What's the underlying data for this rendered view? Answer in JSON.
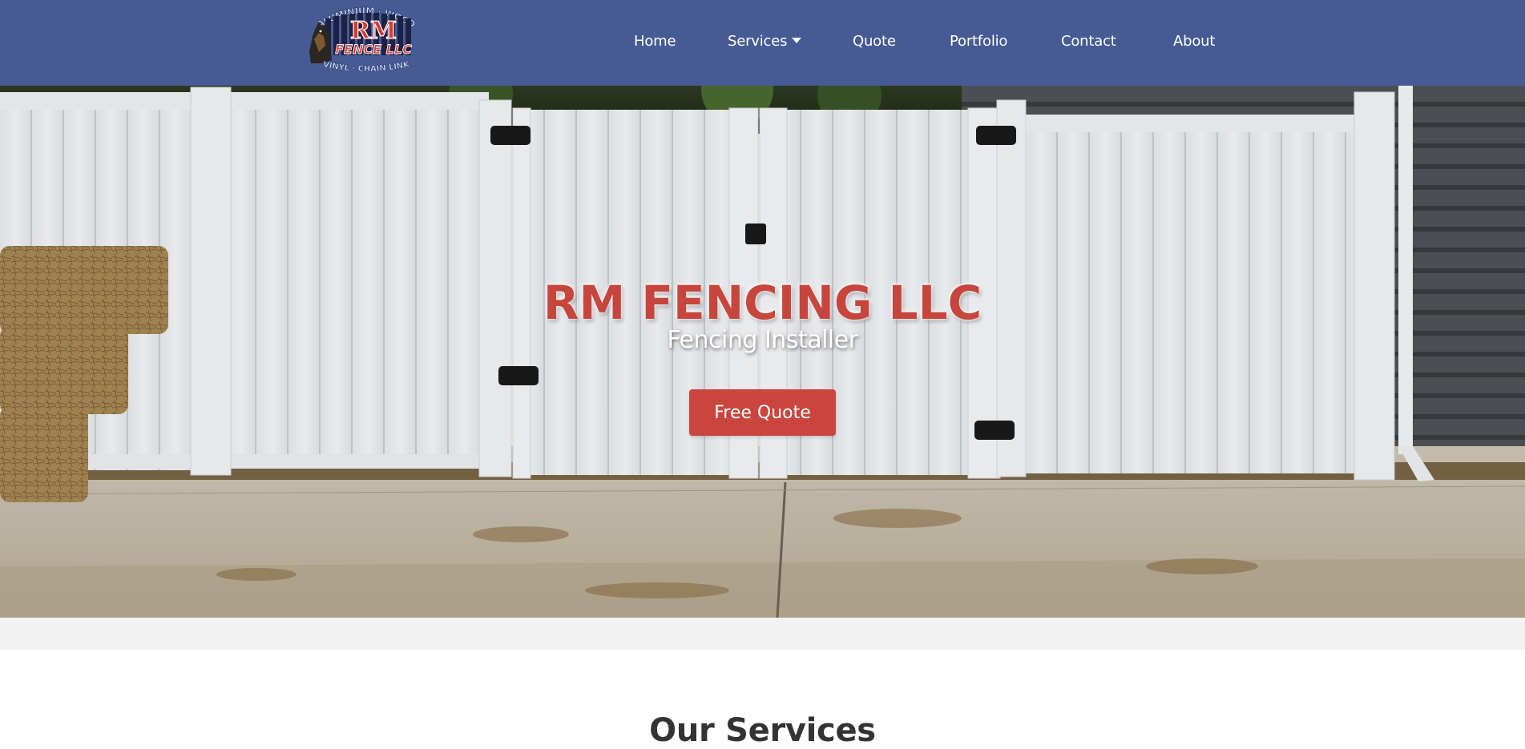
{
  "header": {
    "logo": {
      "top_text": "ALUMINIUM · WOOD",
      "brand_main": "RM",
      "brand_sub": "FENCE LLC",
      "bottom_text": "VINYL · CHAIN LINK"
    },
    "nav": [
      {
        "label": "Home"
      },
      {
        "label": "Services",
        "has_dropdown": true
      },
      {
        "label": "Quote"
      },
      {
        "label": "Portfolio"
      },
      {
        "label": "Contact"
      },
      {
        "label": "About"
      }
    ]
  },
  "hero": {
    "title": "RM FENCING LLC",
    "subtitle": "Fencing Installer",
    "cta_label": "Free Quote"
  },
  "services": {
    "heading": "Our Services"
  },
  "colors": {
    "header_bg": "#465a93",
    "accent_red": "#c9453d",
    "heading_dark": "#333333"
  },
  "icons": [
    "chevron-down-icon",
    "logo-dog-icon"
  ]
}
